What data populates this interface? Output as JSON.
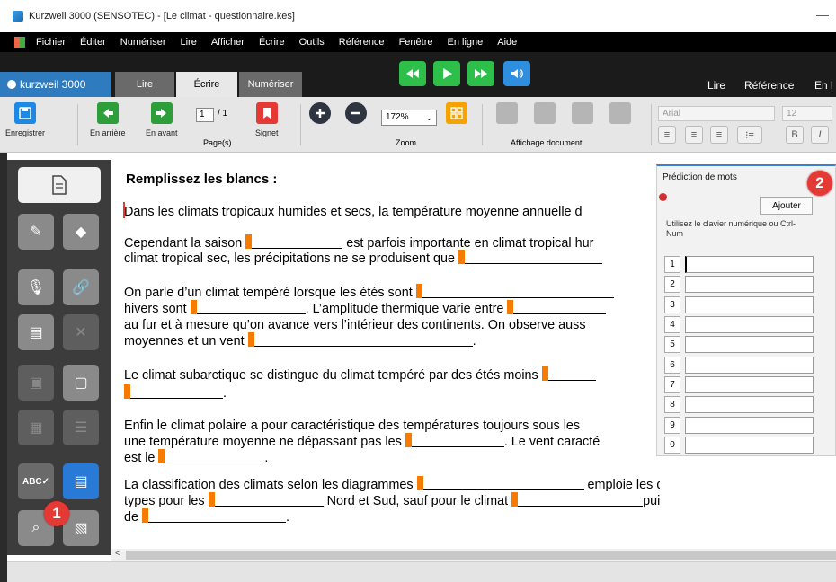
{
  "window": {
    "title": "Kurzweil 3000 (SENSOTEC) - [Le climat - questionnaire.kes]",
    "minimize": "—"
  },
  "menu": [
    "Fichier",
    "Éditer",
    "Numériser",
    "Lire",
    "Afficher",
    "Écrire",
    "Outils",
    "Référence",
    "Fenêtre",
    "En ligne",
    "Aide"
  ],
  "tabs": {
    "brand": "kurzweil 3000",
    "lire": "Lire",
    "ecrire": "Écrire",
    "numeriser": "Numériser"
  },
  "topright": {
    "lire": "Lire",
    "reference": "Référence",
    "en": "En l"
  },
  "ribbon": {
    "save": "Enregistrer",
    "back": "En arrière",
    "forward": "En avant",
    "page_current": "1",
    "page_total": "/ 1",
    "pages_label": "Page(s)",
    "bookmark": "Signet",
    "zoom_value": "172%",
    "zoom_label": "Zoom",
    "display_label": "Affichage document",
    "font_name": "Arial",
    "font_size": "12",
    "bold": "B",
    "italic": "I"
  },
  "doc": {
    "heading": "Remplissez les blancs :",
    "p1": "Dans les climats tropicaux humides et secs, la température moyenne annuelle d",
    "p2a": "Cependant la saison",
    "p2b": "est parfois importante en climat tropical hur",
    "p2c": "climat tropical sec, les précipitations ne se produisent que",
    "p3a": "On parle d’un climat tempéré lorsque les étés sont",
    "p3b": "hivers sont",
    "p3c": ". L’amplitude thermique varie entre",
    "p3d": "au fur et à mesure qu’on avance vers l’intérieur des continents. On observe auss",
    "p3e": "moyennes et un vent",
    "p3f": ".",
    "p4a": "Le climat subarctique se distingue du climat tempéré par des étés moins",
    "p4b": ".",
    "p5a": "Enfin le climat polaire a pour caractéristique des températures toujours sous les",
    "p5b": "une température moyenne ne dépassant pas les",
    "p5c": ". Le vent caracté",
    "p5d": "est le",
    "p5e": ".",
    "p6a": "La classification des climats selon les diagrammes",
    "p6b": "emploie les diagrammes",
    "p6c": "types pour les",
    "p6d": "Nord et Sud, sauf pour le climat",
    "p6e": "puisqu’il n’a pas",
    "p6f": "de",
    "p6g": "."
  },
  "prediction": {
    "title": "Prédiction de mots",
    "add": "Ajouter",
    "hint": "Utilisez le clavier numérique ou Ctrl-Num",
    "rows": [
      "1",
      "2",
      "3",
      "4",
      "5",
      "6",
      "7",
      "8",
      "9",
      "0"
    ]
  },
  "badges": {
    "one": "1",
    "two": "2"
  },
  "scroll": {
    "left_arrow": "<"
  },
  "colors": {
    "marker": "#f57c00",
    "accent": "#2979d6",
    "badge": "#e53935"
  }
}
